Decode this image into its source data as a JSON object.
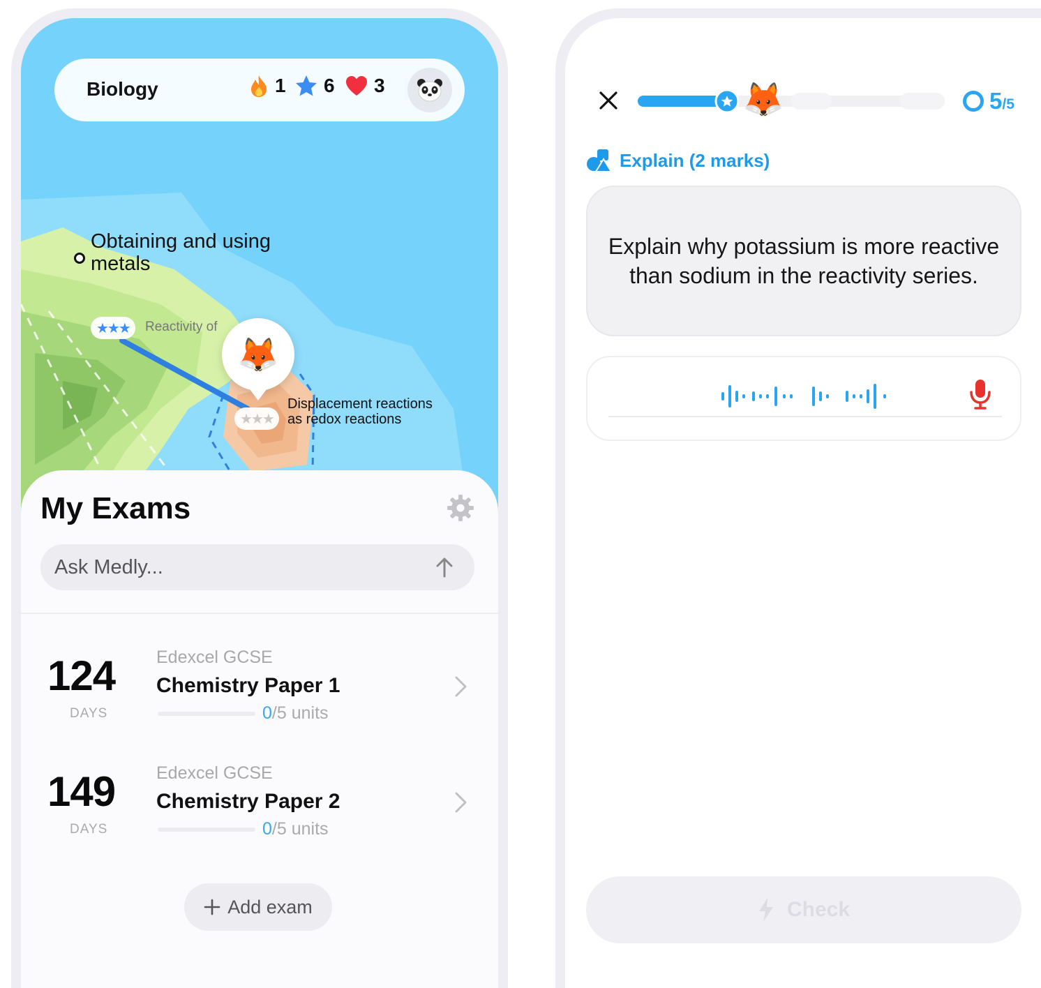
{
  "home": {
    "subject": "Biology",
    "stats": [
      {
        "icon": "flame-icon",
        "value": "1",
        "color": "#ff8a1f"
      },
      {
        "icon": "star-icon",
        "value": "6",
        "color": "#3b8df5"
      },
      {
        "icon": "heart-icon",
        "value": "3",
        "color": "#f0303e"
      }
    ],
    "avatar_icon": "panda-icon",
    "map": {
      "title": "Obtaining and using metals",
      "node_reactivity": "Reactivity of",
      "node_reactivity_stars": "★★★",
      "node_displacement": "Displacement reactions as redox reactions",
      "node_displacement_stars": "★★★",
      "current_marker": "🦊"
    },
    "sheet_title": "My Exams",
    "ask_placeholder": "Ask Medly...",
    "exams": [
      {
        "days": "124",
        "days_label": "DAYS",
        "board": "Edexcel GCSE",
        "name": "Chemistry Paper 1",
        "units_done": "0",
        "units_rest": "/5 units"
      },
      {
        "days": "149",
        "days_label": "DAYS",
        "board": "Edexcel GCSE",
        "name": "Chemistry Paper 2",
        "units_done": "0",
        "units_rest": "/5 units"
      }
    ],
    "add_exam": "Add exam"
  },
  "question": {
    "fox": "🦊",
    "score_num": "5",
    "score_den": "/5",
    "type_label": "Explain (2 marks)",
    "prompt": "Explain why potassium is more reactive than sodium in the reactivity series.",
    "check_label": "Check",
    "accent": "#2aa5f2",
    "mic_color": "#e8322e"
  }
}
